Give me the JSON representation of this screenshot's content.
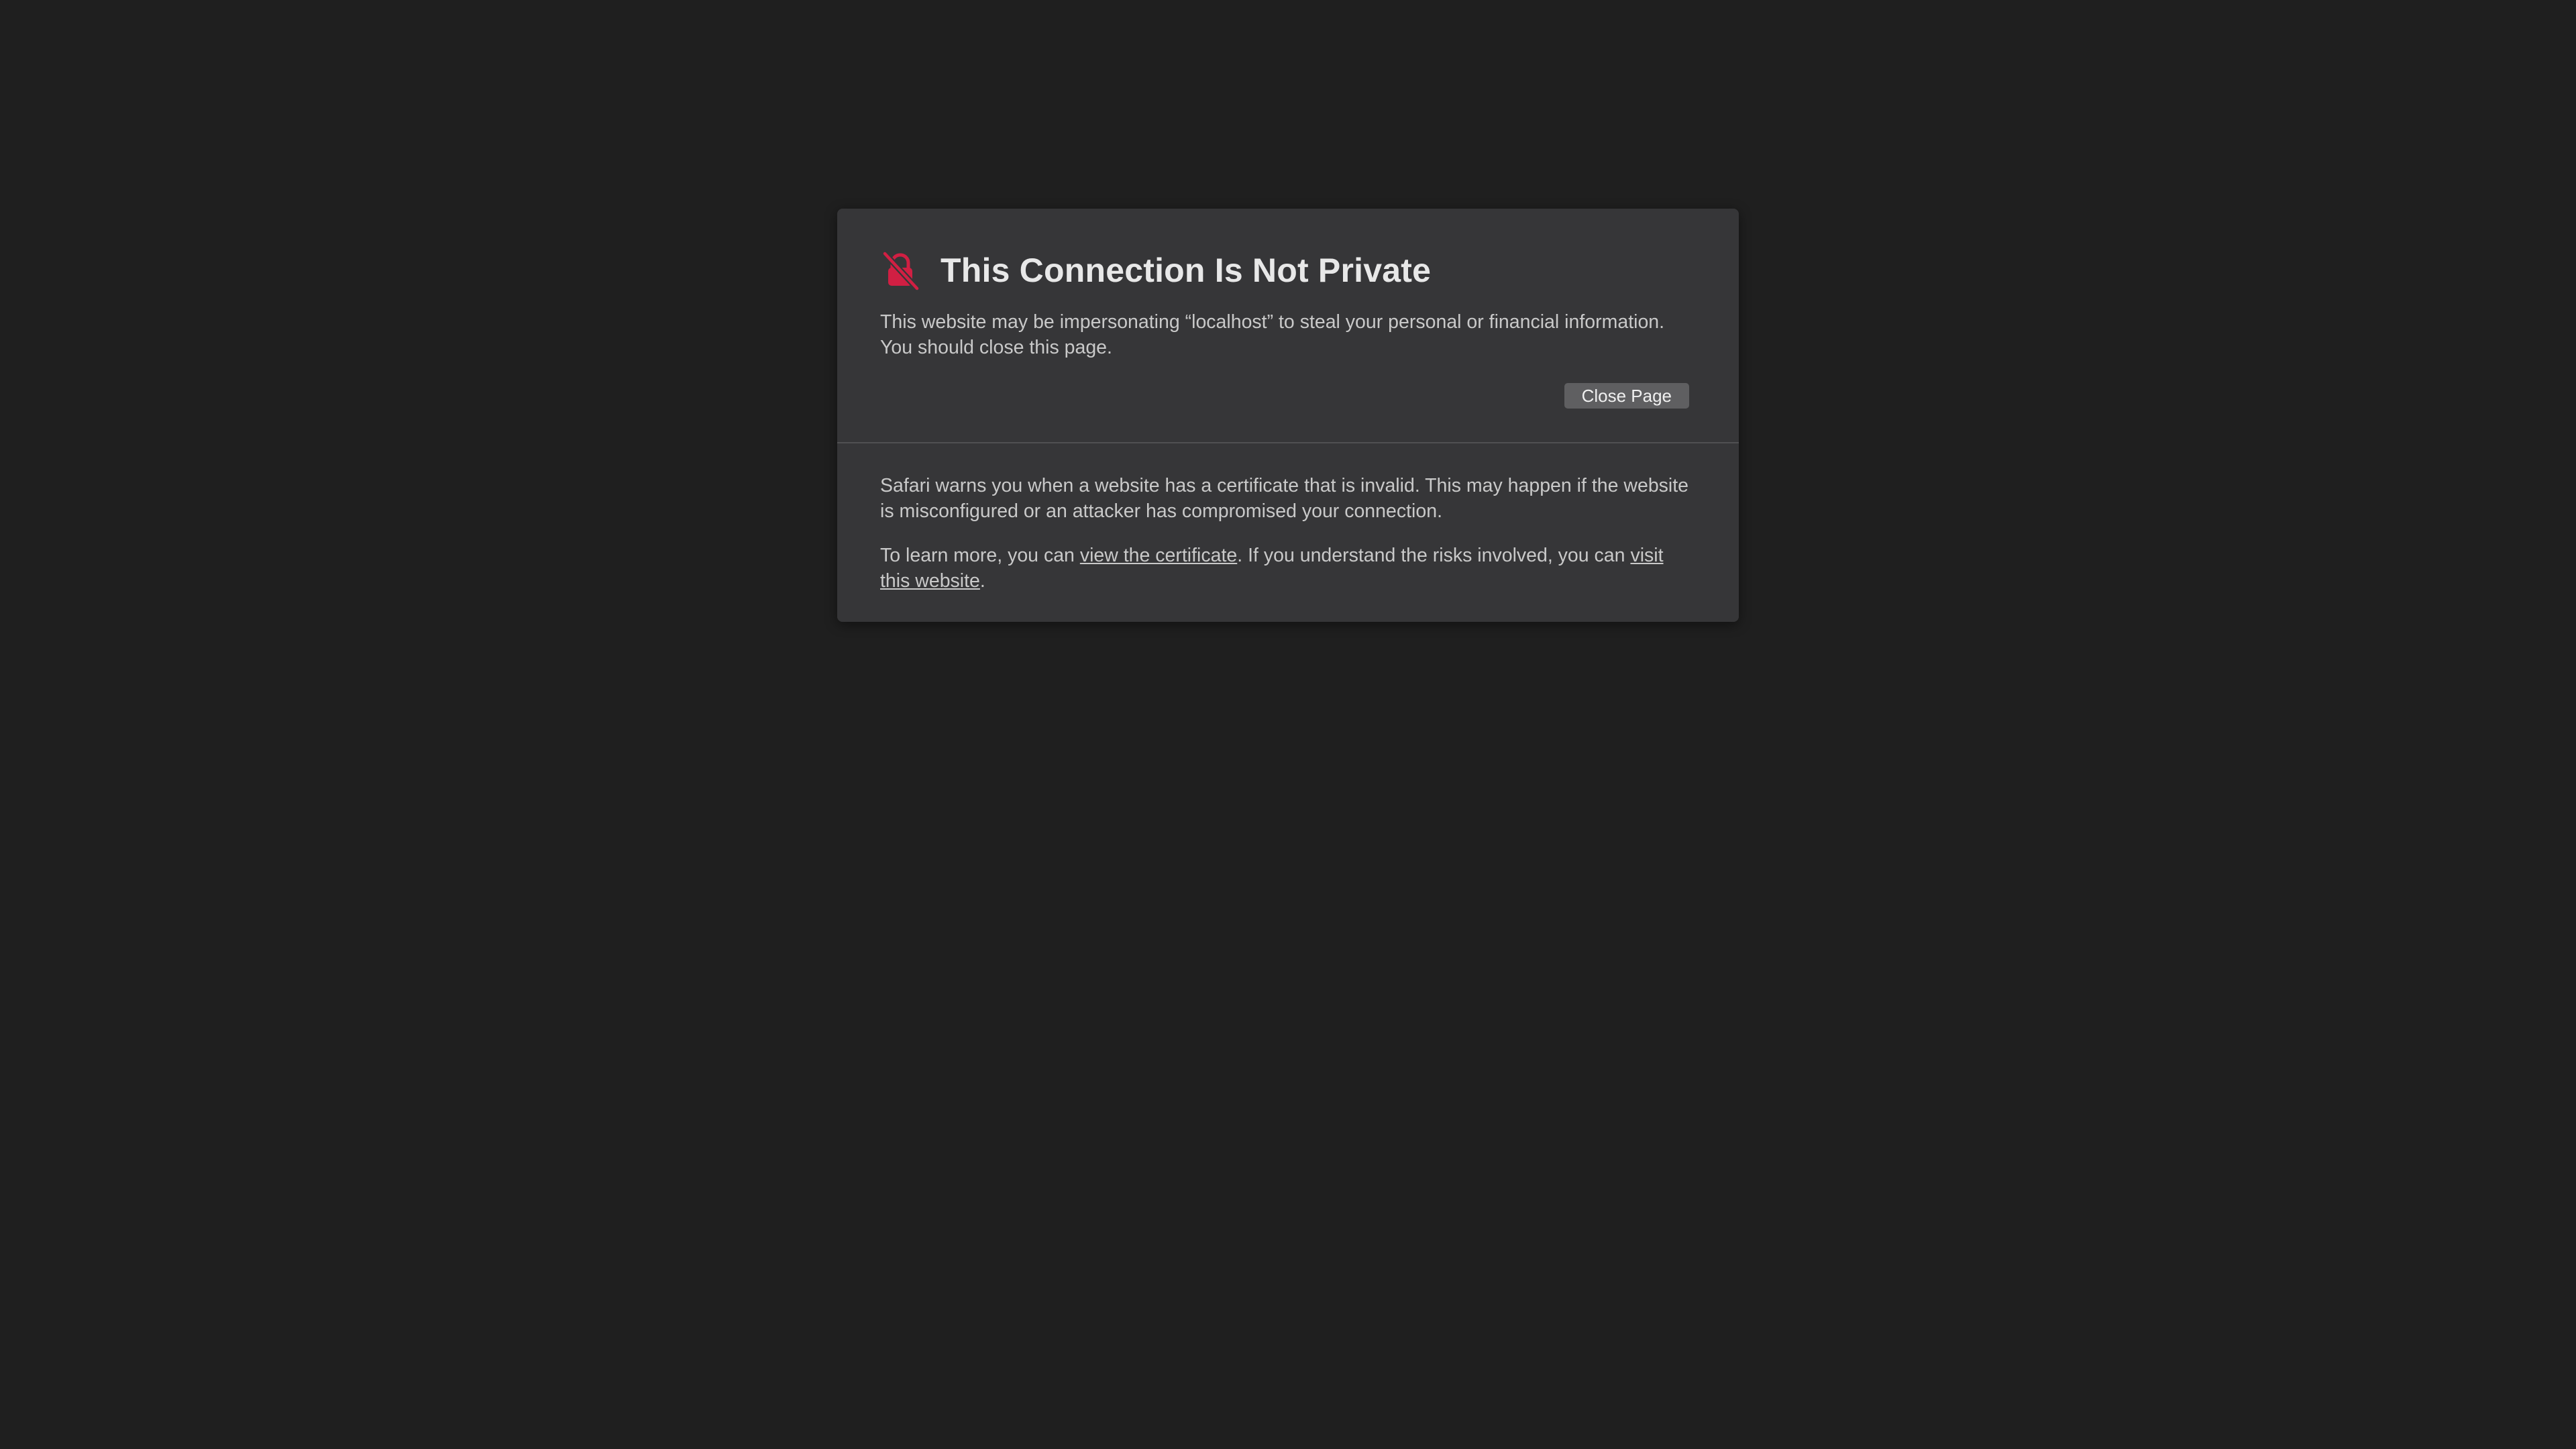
{
  "dialog": {
    "icon": "lock-slash-icon",
    "icon_color": "#d11f43",
    "title": "This Connection Is Not Private",
    "description_line1": "This website may be impersonating “localhost” to steal your personal or financial information.",
    "description_line2": "You should close this page.",
    "close_button_label": "Close Page"
  },
  "details": {
    "paragraph1": "Safari warns you when a website has a certificate that is invalid. This may happen if the website is misconfigured or an attacker has compromised your connection.",
    "learn_prefix": "To learn more, you can ",
    "view_certificate_link": "view the certificate",
    "learn_middle": ". If you understand the risks involved, you can ",
    "visit_website_link": "visit this website",
    "learn_suffix": "."
  }
}
